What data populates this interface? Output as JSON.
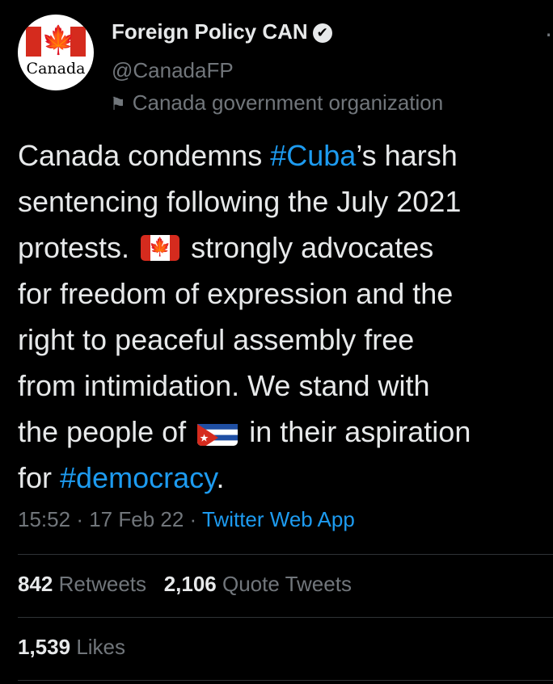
{
  "profile": {
    "avatar_text": "Canada",
    "display_name": "Foreign Policy CAN",
    "handle": "@CanadaFP",
    "label": "Canada government organization"
  },
  "tweet": {
    "lines": [
      {
        "before": "Canada condemns ",
        "link": "#Cuba",
        "after": "’s harsh"
      },
      {
        "text": "sentencing following the July 2021"
      },
      {
        "before": "protests. ",
        "emoji": "flag-canada",
        "after": " strongly advocates"
      },
      {
        "text": "for freedom of expression and the"
      },
      {
        "text": "right to peaceful assembly free"
      },
      {
        "text": "from intimidation. We stand with"
      },
      {
        "before": "the people of ",
        "emoji": "flag-cuba",
        "after": " in their aspiration"
      },
      {
        "before": "for ",
        "link": "#democracy",
        "after": "."
      }
    ]
  },
  "meta": {
    "time": "15:52",
    "date": "17 Feb 22",
    "separator": "·",
    "app": "Twitter Web App"
  },
  "stats": {
    "retweets_count": "842",
    "retweets_label": "Retweets",
    "quotes_count": "2,106",
    "quotes_label": "Quote Tweets",
    "likes_count": "1,539",
    "likes_label": "Likes"
  },
  "icons": {
    "verified": "verified-badge-icon",
    "label": "flag-outline-icon",
    "more": "more-options-icon"
  },
  "colors": {
    "background": "#000000",
    "text": "#e7e9ea",
    "secondary": "#71767b",
    "link": "#1d9bf0",
    "divider": "#2f3336"
  }
}
